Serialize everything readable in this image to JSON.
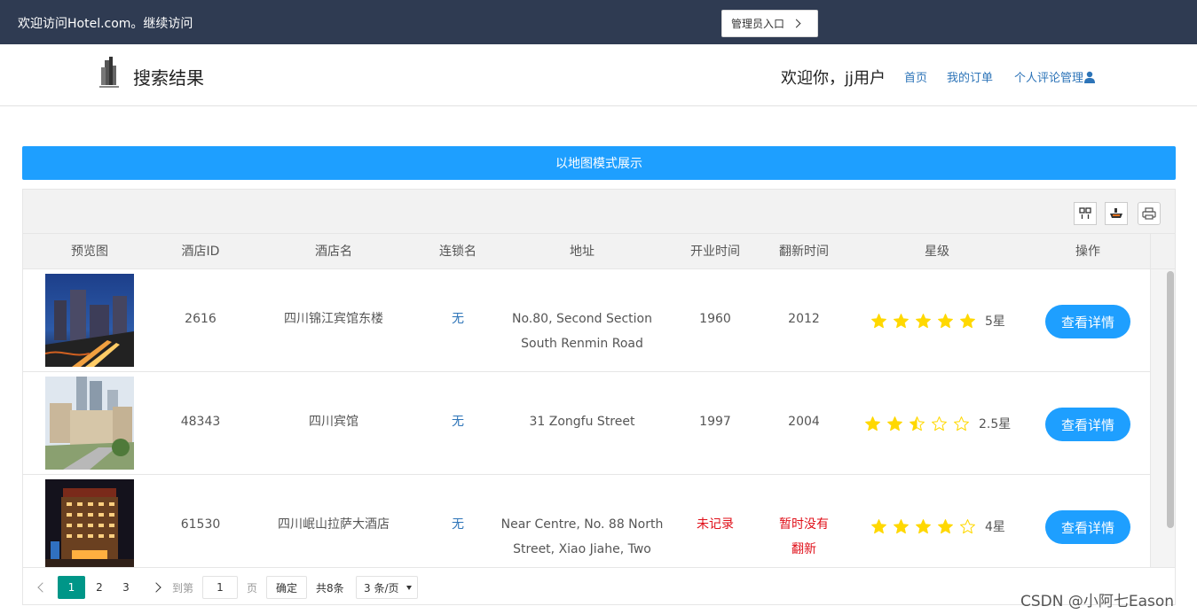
{
  "topbar": {
    "welcome": "欢迎访问Hotel.com。继续访问",
    "admin_label": "管理员入口"
  },
  "header": {
    "title": "搜索结果",
    "greeting": "欢迎你，jj用户",
    "nav": {
      "home": "首页",
      "orders": "我的订单",
      "reviews": "个人评论管理"
    }
  },
  "map_button": "以地图模式展示",
  "icons": {
    "columns": "columns-icon",
    "export": "export-icon",
    "print": "print-icon",
    "user": "user-icon",
    "star": "star-icon"
  },
  "colors": {
    "topbar": "#2f3b52",
    "primary": "#1e9fff",
    "pager_active": "#009688",
    "star": "#ffd800",
    "link": "#2d74b8",
    "alert": "#e0101a"
  },
  "table": {
    "headers": [
      "预览图",
      "酒店ID",
      "酒店名",
      "连锁名",
      "地址",
      "开业时间",
      "翻新时间",
      "星级",
      "操作"
    ],
    "rows": [
      {
        "id": "2616",
        "name": "四川锦江宾馆东楼",
        "chain": "无",
        "address_line1": "No.80, Second Section",
        "address_line2": "South Renmin Road",
        "opened": "1960",
        "renovated_line1": "2012",
        "renovated_line2": "",
        "rating": 5,
        "rating_label": "5星",
        "action": "查看详情"
      },
      {
        "id": "48343",
        "name": "四川宾馆",
        "chain": "无",
        "address_line1": "31 Zongfu Street",
        "address_line2": "",
        "opened": "1997",
        "renovated_line1": "2004",
        "renovated_line2": "",
        "rating": 2.5,
        "rating_label": "2.5星",
        "action": "查看详情"
      },
      {
        "id": "61530",
        "name": "四川岷山拉萨大酒店",
        "chain": "无",
        "address_line1": "Near Centre, No. 88 North",
        "address_line2": "Street, Xiao Jiahe, Two",
        "opened": "未记录",
        "renovated_line1": "暂时没有",
        "renovated_line2": "翻新",
        "rating": 4,
        "rating_label": "4星",
        "action": "查看详情"
      }
    ]
  },
  "pager": {
    "pages": [
      "1",
      "2",
      "3"
    ],
    "current": "1",
    "goto_label": "到第",
    "goto_value": "1",
    "page_unit": "页",
    "confirm": "确定",
    "total": "共8条",
    "page_size": "3 条/页"
  },
  "watermark": "CSDN @小阿七Eason"
}
